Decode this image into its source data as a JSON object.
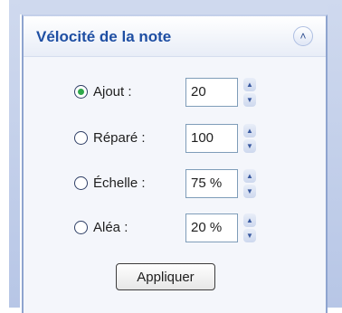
{
  "panel": {
    "title": "Vélocité de la note",
    "collapse_icon": "chevron-double-up-icon"
  },
  "options": [
    {
      "label": "Ajout :",
      "value": "20",
      "checked": true
    },
    {
      "label": "Réparé :",
      "value": "100",
      "checked": false
    },
    {
      "label": "Échelle :",
      "value": "75 %",
      "checked": false
    },
    {
      "label": "Aléa :",
      "value": "20 %",
      "checked": false
    }
  ],
  "apply_label": "Appliquer",
  "colors": {
    "title": "#1f4fa3",
    "radio_selected": "#2fa84a",
    "panel_border": "#8ea4cf"
  }
}
